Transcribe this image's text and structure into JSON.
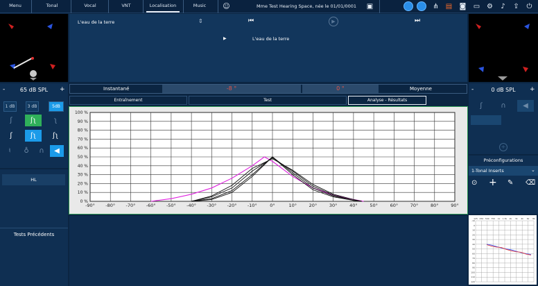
{
  "top_tabs": [
    "Menu",
    "Tonal",
    "Vocal",
    "VNT",
    "Localisation",
    "Music"
  ],
  "active_tab": "Localisation",
  "patient_label": "Mme Test Hearing Space, née le 01/01/0001",
  "player": {
    "track_select": "L'eau de la terre",
    "now_playing": "L'eau de la terre"
  },
  "left_panel": {
    "level_label": "65 dB SPL",
    "minus": "-",
    "plus": "+",
    "step_buttons": [
      "1 dB",
      "3 dB",
      "5dB"
    ],
    "hl_label": "HL",
    "previous_tests": "Tests Précédents"
  },
  "right_panel": {
    "level_label": "0 dB SPL",
    "minus": "-",
    "plus": "+",
    "presets_title": "Préconfigurations",
    "preset_value": "1-Tonal Inserts"
  },
  "stats": {
    "instant_label": "Instantané",
    "instant_value": "-8 °",
    "average_value": "0 °",
    "average_label": "Moyenne"
  },
  "mode_tabs": [
    "Entraînement",
    "Test",
    "Analyse - Résultats"
  ],
  "active_mode": "Analyse - Résultats",
  "colors": {
    "accent": "#1b9be9",
    "magenta": "#e020e0",
    "green": "#2fb05a",
    "value_red": "#e2564a"
  },
  "chart_data": {
    "type": "line",
    "x": [
      -90,
      -80,
      -70,
      -60,
      -50,
      -40,
      -30,
      -20,
      -10,
      0,
      10,
      20,
      30,
      40,
      50,
      60,
      70,
      80,
      90
    ],
    "xticks": [
      "-90°",
      "-80°",
      "-70°",
      "-60°",
      "-50°",
      "-40°",
      "-30°",
      "-20°",
      "-10°",
      "0°",
      "10°",
      "20°",
      "30°",
      "40°",
      "50°",
      "60°",
      "70°",
      "80°",
      "90°"
    ],
    "yticks": [
      "0 %",
      "10 %",
      "20 %",
      "30 %",
      "40 %",
      "50 %",
      "60 %",
      "70 %",
      "80 %",
      "90 %",
      "100 %"
    ],
    "xlim": [
      -90,
      90
    ],
    "ylim": [
      0,
      100
    ],
    "grid": true,
    "series": [
      {
        "color": "#e020e0",
        "points": [
          [
            -60,
            0
          ],
          [
            -50,
            3
          ],
          [
            -40,
            8
          ],
          [
            -30,
            15
          ],
          [
            -20,
            26
          ],
          [
            -10,
            40
          ],
          [
            -4,
            50
          ],
          [
            0,
            45
          ],
          [
            10,
            28
          ],
          [
            20,
            15
          ],
          [
            30,
            7
          ],
          [
            40,
            2
          ],
          [
            45,
            0
          ]
        ]
      },
      {
        "color": "#111111",
        "points": [
          [
            -40,
            0
          ],
          [
            -30,
            3
          ],
          [
            -20,
            12
          ],
          [
            -10,
            30
          ],
          [
            0,
            50
          ],
          [
            10,
            32
          ],
          [
            20,
            15
          ],
          [
            30,
            6
          ],
          [
            40,
            1
          ],
          [
            44,
            0
          ]
        ]
      },
      {
        "color": "#111111",
        "points": [
          [
            -40,
            0
          ],
          [
            -30,
            5
          ],
          [
            -20,
            15
          ],
          [
            -10,
            34
          ],
          [
            0,
            49
          ],
          [
            10,
            34
          ],
          [
            20,
            17
          ],
          [
            30,
            7
          ],
          [
            40,
            1
          ],
          [
            44,
            0
          ]
        ]
      },
      {
        "color": "#111111",
        "points": [
          [
            -40,
            0
          ],
          [
            -30,
            6
          ],
          [
            -20,
            18
          ],
          [
            -10,
            37
          ],
          [
            0,
            48
          ],
          [
            10,
            35
          ],
          [
            20,
            19
          ],
          [
            30,
            8
          ],
          [
            40,
            2
          ],
          [
            44,
            0
          ]
        ]
      },
      {
        "color": "#111111",
        "points": [
          [
            -40,
            0
          ],
          [
            -30,
            2
          ],
          [
            -20,
            10
          ],
          [
            -10,
            28
          ],
          [
            0,
            50
          ],
          [
            10,
            30
          ],
          [
            20,
            13
          ],
          [
            30,
            5
          ],
          [
            40,
            1
          ],
          [
            44,
            0
          ]
        ]
      }
    ]
  },
  "mini_audiogram": {
    "freq_labels": [
      "125",
      "250",
      "500",
      "750",
      "1k",
      "1.5k",
      "2k",
      "3k",
      "4k",
      "6k",
      "8k"
    ],
    "db_labels": [
      "-10",
      "0",
      "10",
      "20",
      "30",
      "40",
      "50",
      "60",
      "70",
      "80",
      "90",
      "100",
      "110",
      "120"
    ],
    "series": [
      {
        "color": "#3a5cff",
        "values": [
          40,
          42,
          45,
          48,
          50,
          52,
          55,
          58,
          60,
          62
        ]
      },
      {
        "color": "#e23a3a",
        "values": [
          41,
          44,
          46,
          47,
          51,
          54,
          56,
          57,
          61,
          63
        ]
      }
    ]
  }
}
